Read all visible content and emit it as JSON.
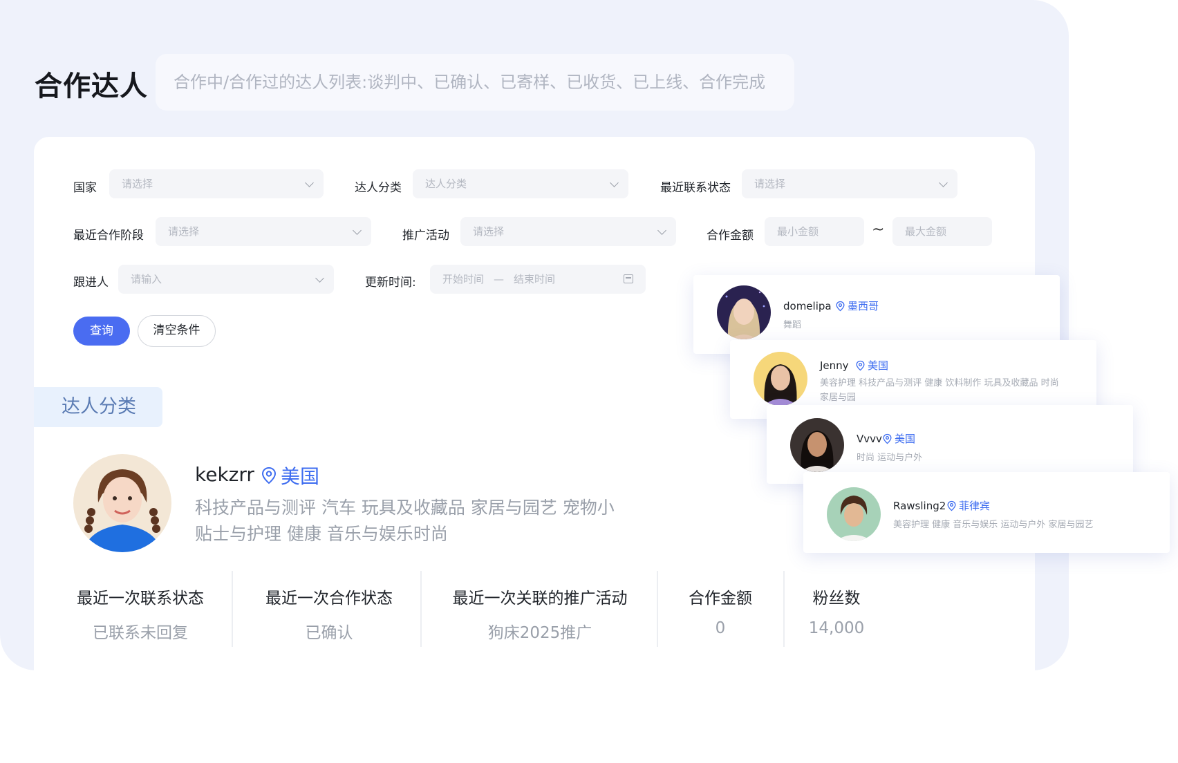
{
  "header": {
    "title": "合作达人",
    "description": "合作中/合作过的达人列表:谈判中、已确认、已寄样、已收货、已上线、合作完成"
  },
  "filters": {
    "country": {
      "label": "国家",
      "placeholder": "请选择"
    },
    "category": {
      "label": "达人分类",
      "placeholder": "达人分类"
    },
    "contact_status": {
      "label": "最近联系状态",
      "placeholder": "请选择"
    },
    "coop_stage": {
      "label": "最近合作阶段",
      "placeholder": "请选择"
    },
    "campaign": {
      "label": "推广活动",
      "placeholder": "请选择"
    },
    "amount": {
      "label": "合作金额",
      "min_placeholder": "最小金额",
      "separator": "~",
      "max_placeholder": "最大金额"
    },
    "follower": {
      "label": "跟进人",
      "placeholder": "请输入"
    },
    "update_time": {
      "label": "更新时间:",
      "start_placeholder": "开始时间",
      "dash": "—",
      "end_placeholder": "结束时间"
    }
  },
  "actions": {
    "query": "查询",
    "clear": "清空条件"
  },
  "section": {
    "tag": "达人分类"
  },
  "influencer": {
    "name": "kekzrr",
    "country": "美国",
    "tags": "科技产品与测评 汽车 玩具及收藏品 家居与园艺 宠物小贴士与护理 健康 音乐与娱乐时尚"
  },
  "stats": [
    {
      "label": "最近一次联系状态",
      "value": "已联系未回复"
    },
    {
      "label": "最近一次合作状态",
      "value": "已确认"
    },
    {
      "label": "最近一次关联的推广活动",
      "value": "狗床2025推广"
    },
    {
      "label": "合作金额",
      "value": "0"
    },
    {
      "label": "粉丝数",
      "value": "14,000"
    }
  ],
  "cards": [
    {
      "name": "domelipa",
      "country": "墨西哥",
      "tags": "舞蹈"
    },
    {
      "name": "Jenny",
      "country": "美国",
      "tags": "美容护理 科技产品与测评 健康 饮料制作 玩具及收藏品 时尚家居与园"
    },
    {
      "name": "Vvvv",
      "country": "美国",
      "tags": "时尚 运动与户外"
    },
    {
      "name": "Rawsling2",
      "country": "菲律宾",
      "tags": "美容护理 健康 音乐与娱乐 运动与户外 家居与园艺"
    }
  ],
  "colors": {
    "accent": "#4a6cf1",
    "location": "#3d6cf0",
    "background": "#eff2fb"
  },
  "icons": {
    "dropdown": "chevron-down-icon",
    "location": "location-pin-icon",
    "calendar": "calendar-icon"
  }
}
